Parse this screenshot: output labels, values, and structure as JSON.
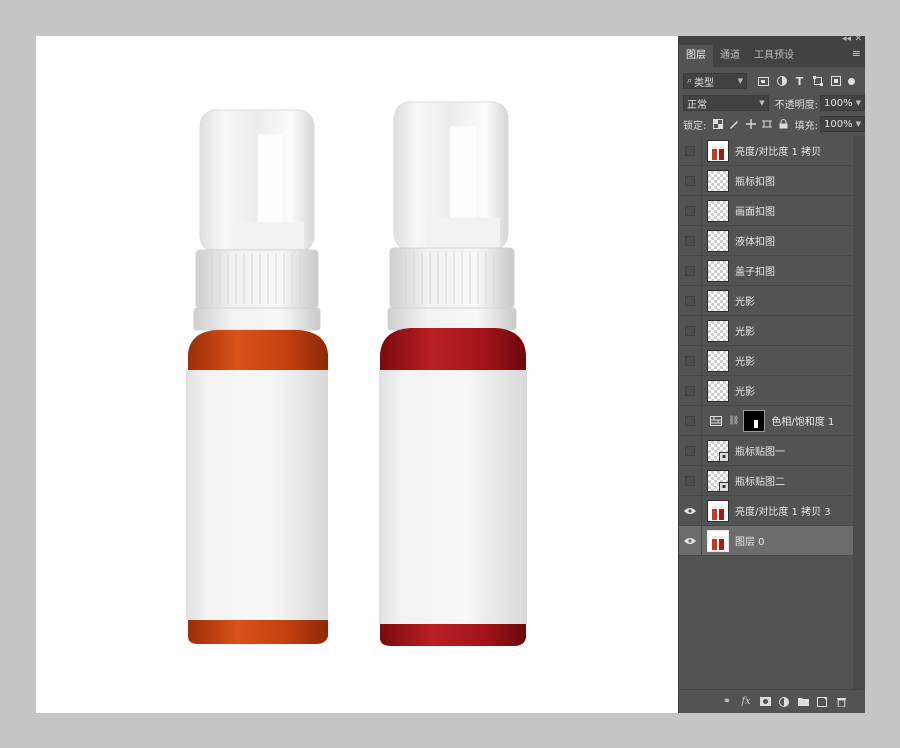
{
  "panel": {
    "tabs": [
      {
        "label": "图层",
        "active": true
      },
      {
        "label": "通道",
        "active": false
      },
      {
        "label": "工具预设",
        "active": false
      }
    ],
    "filter_kind": "类型",
    "blend_mode": "正常",
    "opacity_label": "不透明度:",
    "opacity_value": "100%",
    "lock_label": "锁定:",
    "fill_label": "填充:",
    "fill_value": "100%"
  },
  "layers": [
    {
      "name": "亮度/对比度 1 拷贝",
      "visible": false,
      "thumb": "photo"
    },
    {
      "name": "瓶标扣图",
      "visible": false,
      "thumb": "transparent"
    },
    {
      "name": "画面扣图",
      "visible": false,
      "thumb": "transparent"
    },
    {
      "name": "液体扣图",
      "visible": false,
      "thumb": "transparent"
    },
    {
      "name": "盖子扣图",
      "visible": false,
      "thumb": "transparent"
    },
    {
      "name": "光影",
      "visible": false,
      "thumb": "transparent"
    },
    {
      "name": "光影",
      "visible": false,
      "thumb": "transparent"
    },
    {
      "name": "光影",
      "visible": false,
      "thumb": "transparent"
    },
    {
      "name": "光影",
      "visible": false,
      "thumb": "transparent"
    },
    {
      "name": "色相/饱和度 1",
      "visible": false,
      "thumb": "adjustment"
    },
    {
      "name": "瓶标贴图一",
      "visible": false,
      "thumb": "smart"
    },
    {
      "name": "瓶标贴图二",
      "visible": false,
      "thumb": "smart"
    },
    {
      "name": "亮度/对比度 1 拷贝 3",
      "visible": true,
      "thumb": "photo"
    },
    {
      "name": "图层 0",
      "visible": true,
      "thumb": "photo",
      "selected": true
    }
  ],
  "bottom_icons": [
    "link-icon",
    "fx-icon",
    "mask-icon",
    "adjustment-icon",
    "folder-icon",
    "new-layer-icon",
    "trash-icon"
  ],
  "colors": {
    "bottle_left_liquid": "#c8420f",
    "bottle_right_liquid": "#a8161a",
    "panel_bg": "#535353"
  }
}
